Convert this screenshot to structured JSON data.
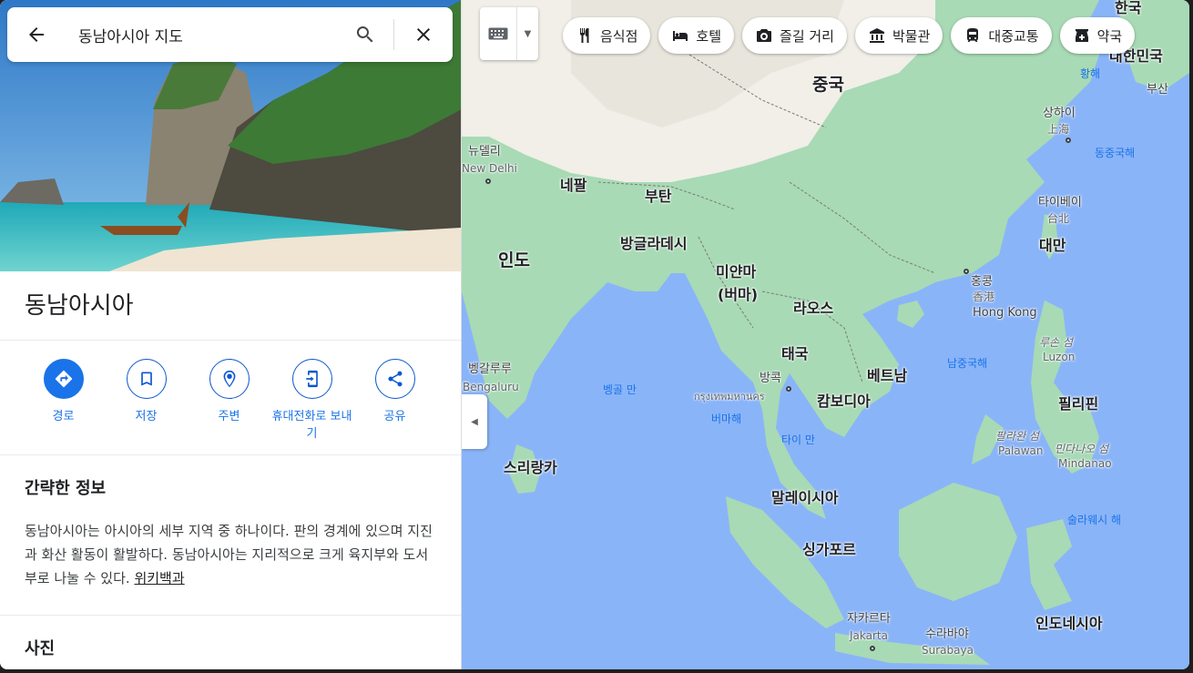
{
  "search": {
    "value": "동남아시아 지도"
  },
  "place": {
    "title": "동남아시아",
    "actions": [
      {
        "label": "경로"
      },
      {
        "label": "저장"
      },
      {
        "label": "주변"
      },
      {
        "label": "휴대전화로 보내기"
      },
      {
        "label": "공유"
      }
    ]
  },
  "summary": {
    "heading": "간략한 정보",
    "text": "동남아시아는 아시아의 세부 지역 중 하나이다. 판의 경계에 있으며 지진과 화산 활동이 활발하다. 동남아시아는 지리적으로 크게 육지부와 도서부로 나눌 수 있다. ",
    "link": "위키백과"
  },
  "photos": {
    "heading": "사진"
  },
  "map_chips": [
    {
      "label": "음식점",
      "icon": "restaurant-icon"
    },
    {
      "label": "호텔",
      "icon": "hotel-icon"
    },
    {
      "label": "즐길 거리",
      "icon": "camera-icon"
    },
    {
      "label": "박물관",
      "icon": "museum-icon"
    },
    {
      "label": "대중교통",
      "icon": "transit-icon"
    },
    {
      "label": "약국",
      "icon": "pharmacy-icon"
    }
  ],
  "map_labels": {
    "china": "중국",
    "india": "인도",
    "nepal": "네팔",
    "bhutan": "부탄",
    "bangladesh": "방글라데시",
    "myanmar": "미얀마",
    "myanmar_alt": "(버마)",
    "laos": "라오스",
    "thailand": "태국",
    "vietnam": "베트남",
    "cambodia": "캄보디아",
    "sri_lanka": "스리랑카",
    "malaysia": "말레이시아",
    "singapore": "싱가포르",
    "indonesia": "인도네시아",
    "philippines": "필리핀",
    "taiwan": "대만",
    "korea": "대한민국",
    "korea_top": "한국",
    "newdelhi_ko": "뉴델리",
    "newdelhi_en": "New Delhi",
    "bengaluru_ko": "벵갈루루",
    "bengaluru_en": "Bengaluru",
    "bangkok_ko": "방콕",
    "bangkok_th": "กรุงเทพมหานคร",
    "hongkong_ko": "홍콩",
    "hongkong_zh": "香港",
    "hongkong_en": "Hong Kong",
    "shanghai_ko": "상하이",
    "shanghai_zh": "上海",
    "taipei_ko": "타이베이",
    "taipei_zh": "台北",
    "busan": "부산",
    "jakarta_ko": "자카르타",
    "jakarta_en": "Jakarta",
    "surabaya_ko": "수라바야",
    "surabaya_en": "Surabaya",
    "luzon_ko": "루손 섬",
    "luzon_en": "Luzon",
    "palawan_ko": "팔라완 섬",
    "palawan_en": "Palawan",
    "mindanao_ko": "민다나오 섬",
    "mindanao_en": "Mindanao",
    "yellow_sea": "황해",
    "east_china_sea": "동중국해",
    "south_china_sea": "남중국해",
    "bay_of_bengal": "벵골 만",
    "andaman_sea": "버마해",
    "gulf_of_thailand": "타이 만",
    "sulawesi_sea": "술라웨시 해"
  },
  "colors": {
    "water": "#8ab4f8",
    "land": "#a8dab5",
    "land_light": "#f1efe8",
    "accent": "#1a73e8"
  }
}
